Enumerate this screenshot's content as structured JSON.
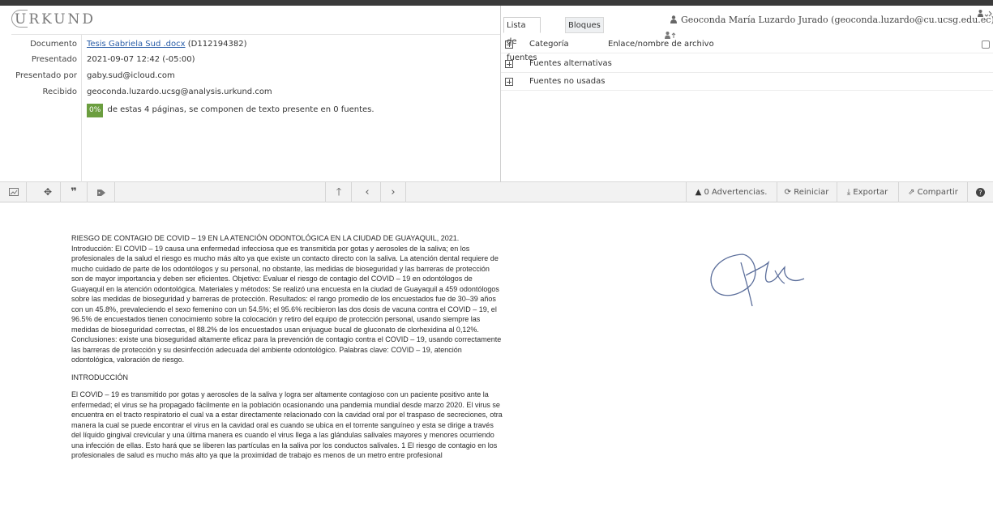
{
  "logo_text": "URKUND",
  "document_info": {
    "documento_label": "Documento",
    "documento_link": "Tesis Gabriela Sud .docx",
    "documento_id": "(D112194382)",
    "presentado_label": "Presentado",
    "presentado_value": "2021-09-07 12:42 (-05:00)",
    "presentado_por_label": "Presentado por",
    "presentado_por_value": "gaby.sud@icloud.com",
    "recibido_label": "Recibido",
    "recibido_value": "geoconda.luzardo.ucsg@analysis.urkund.com",
    "match_percent": "0%",
    "match_text": "de estas 4 páginas, se componen de texto presente en 0 fuentes.",
    "accent_color": "#6b9e3f"
  },
  "tabs": [
    "Lista de fuentes",
    "Bloques"
  ],
  "user_label": "Geoconda María Luzardo Jurado (geoconda.luzardo@cu.ucsg.edu.ec)",
  "sources": {
    "col_category": "Categoría",
    "col_link": "Enlace/nombre de archivo",
    "rows": [
      "Fuentes alternativas",
      "Fuentes no usadas"
    ]
  },
  "toolbar": {
    "icons": [
      "chart-icon",
      "crosshair-icon",
      "quote-icon",
      "tag-icon",
      "up-arrow-icon",
      "prev-icon",
      "next-icon"
    ],
    "warnings": "0 Advertencias.",
    "restart": "Reiniciar",
    "export": "Exportar",
    "share": "Compartir",
    "help_icon": "help-icon"
  },
  "document": {
    "title": "RIESGO DE CONTAGIO DE COVID – 19 EN LA ATENCIÓN ODONTOLÓGICA EN LA CIUDAD DE GUAYAQUIL, 2021.",
    "abstract": "Introducción: El COVID – 19 causa una enfermedad infecciosa que es transmitida por gotas y aerosoles de la saliva; en los profesionales de la salud el riesgo es mucho más alto ya que existe un contacto directo con la saliva. La atención dental requiere de mucho cuidado de parte de los odontólogos y su personal, no obstante, las medidas de bioseguridad y las barreras de protección son de mayor importancia y deben ser eficientes. Objetivo: Evaluar el riesgo de contagio del COVID – 19 en odontólogos de Guayaquil en la atención odontológica. Materiales y métodos: Se realizó una encuesta en la ciudad de Guayaquil a 459 odontólogos sobre las medidas de bioseguridad y barreras de protección. Resultados: el rango promedio de los encuestados fue de 30–39 años con un 45.8%, prevaleciendo el sexo femenino con un 54.5%; el 95.6% recibieron las dos dosis de vacuna contra el COVID – 19, el 96.5% de encuestados tienen conocimiento sobre la colocación y retiro del equipo de protección personal, usando siempre las medidas de bioseguridad correctas, el 88.2% de los encuestados usan enjuague bucal de gluconato de clorhexidina al 0,12%. Conclusiones: existe una bioseguridad altamente eficaz para la prevención de contagio contra el COVID – 19, usando correctamente las barreras de protección y su desinfección adecuada del ambiente odontológico. Palabras clave: COVID – 19, atención odontológica, valoración de riesgo.",
    "section_heading": "INTRODUCCIÓN",
    "intro": "El COVID – 19 es transmitido por gotas y aerosoles de la saliva y logra ser altamente contagioso con un paciente positivo ante la enfermedad; el virus se ha propagado fácilmente en la población ocasionando una pandemia mundial desde marzo 2020. El virus se encuentra en el tracto respiratorio el cual va a estar directamente relacionado con la cavidad oral por el traspaso de secreciones, otra manera la cual se puede encontrar el virus en la cavidad oral es cuando se ubica en el torrente sanguíneo y esta se dirige a través del líquido gingival crevicular y una última manera es cuando el virus llega a las glándulas salivales mayores y menores ocurriendo una infección de ellas. Esto hará que se liberen las partículas en la saliva por los conductos salivales. 1 El riesgo de contagio en los profesionales de salud es mucho más alto ya que la proximidad de trabajo es menos de un metro entre profesional"
  }
}
